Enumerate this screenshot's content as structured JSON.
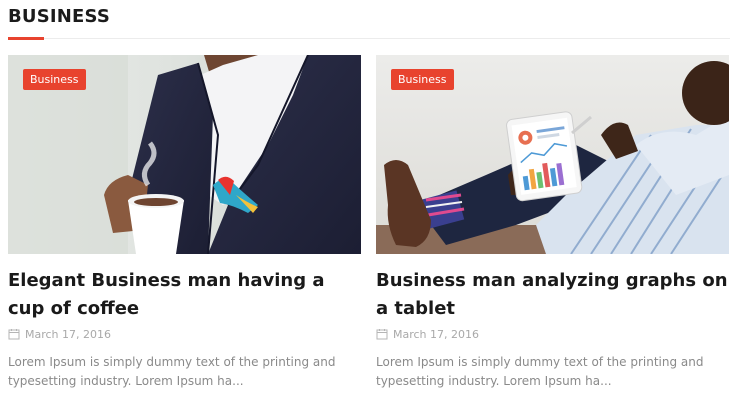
{
  "section": {
    "title": "BUSINESS",
    "accent_color": "#e8432e"
  },
  "cards": [
    {
      "badge": "Business",
      "title": "Elegant Business man having a cup of coffee",
      "date": "March 17, 2016",
      "excerpt": "Lorem Ipsum is simply dummy text of the printing and typesetting industry. Lorem Ipsum ha...",
      "image": "man-in-suit-holding-coffee-photo"
    },
    {
      "badge": "Business",
      "title": "Business man analyzing graphs on a tablet",
      "date": "March 17, 2016",
      "excerpt": "Lorem Ipsum is simply dummy text of the printing and typesetting industry. Lorem Ipsum ha...",
      "image": "man-with-tablet-graphs-photo"
    }
  ],
  "icons": {
    "date": "calendar-icon"
  }
}
